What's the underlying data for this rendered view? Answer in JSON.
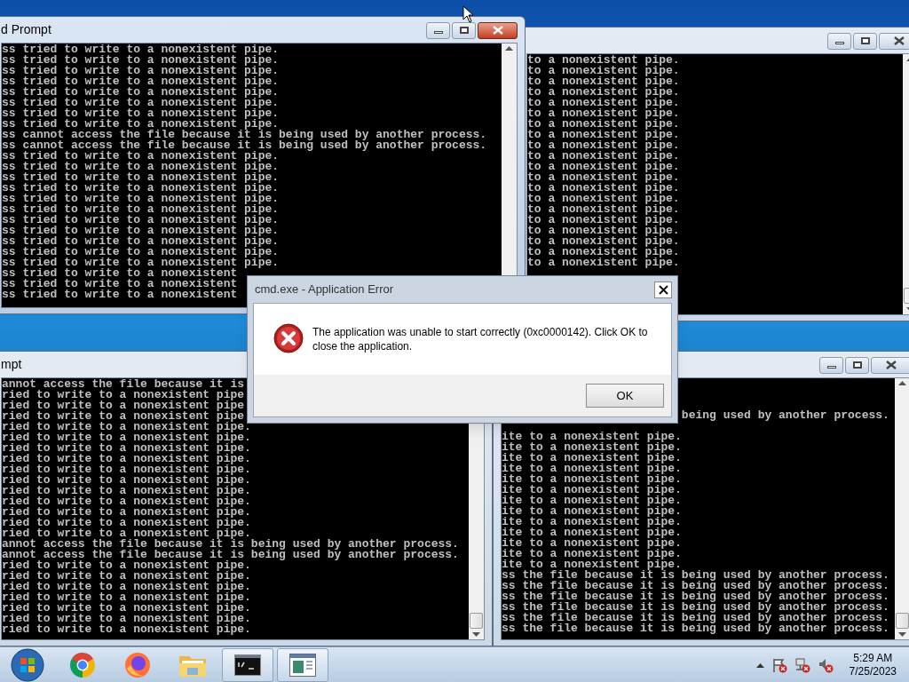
{
  "windows": [
    {
      "title": "d Prompt",
      "active": true,
      "lines": [
        {
          "kind": "full",
          "text": "ss tried to write to a nonexistent pipe."
        },
        {
          "kind": "full",
          "text": "ss tried to write to a nonexistent pipe."
        },
        {
          "kind": "full",
          "text": "ss tried to write to a nonexistent pipe."
        },
        {
          "kind": "full",
          "text": "ss tried to write to a nonexistent pipe."
        },
        {
          "kind": "full",
          "text": "ss tried to write to a nonexistent pipe."
        },
        {
          "kind": "full",
          "text": "ss tried to write to a nonexistent pipe."
        },
        {
          "kind": "full",
          "text": "ss tried to write to a nonexistent pipe."
        },
        {
          "kind": "full",
          "text": "ss tried to write to a nonexistent pipe."
        },
        {
          "kind": "full",
          "text": "ss cannot access the file because it is being used by another process."
        },
        {
          "kind": "full",
          "text": "ss cannot access the file because it is being used by another process."
        },
        {
          "kind": "full",
          "text": "ss tried to write to a nonexistent pipe."
        },
        {
          "kind": "full",
          "text": "ss tried to write to a nonexistent pipe."
        },
        {
          "kind": "full",
          "text": "ss tried to write to a nonexistent pipe."
        },
        {
          "kind": "full",
          "text": "ss tried to write to a nonexistent pipe."
        },
        {
          "kind": "full",
          "text": "ss tried to write to a nonexistent pipe."
        },
        {
          "kind": "full",
          "text": "ss tried to write to a nonexistent pipe."
        },
        {
          "kind": "full",
          "text": "ss tried to write to a nonexistent pipe."
        },
        {
          "kind": "full",
          "text": "ss tried to write to a nonexistent pipe."
        },
        {
          "kind": "full",
          "text": "ss tried to write to a nonexistent pipe."
        },
        {
          "kind": "full",
          "text": "ss tried to write to a nonexistent pipe."
        },
        {
          "kind": "full",
          "text": "ss tried to write to a nonexistent pipe."
        },
        {
          "kind": "full",
          "text": "ss tried to write to a nonexistent"
        },
        {
          "kind": "full",
          "text": "ss tried to write to a nonexistent"
        },
        {
          "kind": "full",
          "text": "ss tried to write to a nonexistent"
        }
      ]
    },
    {
      "active": false,
      "lines": [
        {
          "kind": "full",
          "text": "to a nonexistent pipe."
        },
        {
          "kind": "full",
          "text": "to a nonexistent pipe."
        },
        {
          "kind": "full",
          "text": "to a nonexistent pipe."
        },
        {
          "kind": "full",
          "text": "to a nonexistent pipe."
        },
        {
          "kind": "full",
          "text": "to a nonexistent pipe."
        },
        {
          "kind": "full",
          "text": "to a nonexistent pipe."
        },
        {
          "kind": "full",
          "text": "to a nonexistent pipe."
        },
        {
          "kind": "full",
          "text": "to a nonexistent pipe."
        },
        {
          "kind": "full",
          "text": "to a nonexistent pipe."
        },
        {
          "kind": "full",
          "text": "to a nonexistent pipe."
        },
        {
          "kind": "full",
          "text": "to a nonexistent pipe."
        },
        {
          "kind": "full",
          "text": "to a nonexistent pipe."
        },
        {
          "kind": "full",
          "text": "to a nonexistent pipe."
        },
        {
          "kind": "full",
          "text": "to a nonexistent pipe."
        },
        {
          "kind": "full",
          "text": "to a nonexistent pipe."
        },
        {
          "kind": "full",
          "text": "to a nonexistent pipe."
        },
        {
          "kind": "full",
          "text": "to a nonexistent pipe."
        },
        {
          "kind": "full",
          "text": "to a nonexistent pipe."
        },
        {
          "kind": "full",
          "text": "to a nonexistent pipe."
        },
        {
          "kind": "full",
          "text": "to a nonexistent pipe."
        }
      ]
    },
    {
      "title": "mpt",
      "active": false,
      "lines": [
        {
          "kind": "full",
          "text": "annot access the file because it is"
        },
        {
          "kind": "full",
          "text": "ried to write to a nonexistent pipe"
        },
        {
          "kind": "full",
          "text": "ried to write to a nonexistent pipe"
        },
        {
          "kind": "full",
          "text": "ried to write to a nonexistent pipe"
        },
        {
          "kind": "full",
          "text": "ried to write to a nonexistent pipe."
        },
        {
          "kind": "full",
          "text": "ried to write to a nonexistent pipe."
        },
        {
          "kind": "full",
          "text": "ried to write to a nonexistent pipe."
        },
        {
          "kind": "full",
          "text": "ried to write to a nonexistent pipe."
        },
        {
          "kind": "full",
          "text": "ried to write to a nonexistent pipe."
        },
        {
          "kind": "full",
          "text": "ried to write to a nonexistent pipe."
        },
        {
          "kind": "full",
          "text": "ried to write to a nonexistent pipe."
        },
        {
          "kind": "full",
          "text": "ried to write to a nonexistent pipe."
        },
        {
          "kind": "full",
          "text": "ried to write to a nonexistent pipe."
        },
        {
          "kind": "full",
          "text": "ried to write to a nonexistent pipe."
        },
        {
          "kind": "full",
          "text": "ried to write to a nonexistent pipe."
        },
        {
          "kind": "full",
          "text": "annot access the file because it is being used by another process."
        },
        {
          "kind": "full",
          "text": "annot access the file because it is being used by another process."
        },
        {
          "kind": "full",
          "text": "ried to write to a nonexistent pipe."
        },
        {
          "kind": "full",
          "text": "ried to write to a nonexistent pipe."
        },
        {
          "kind": "full",
          "text": "ried to write to a nonexistent pipe."
        },
        {
          "kind": "full",
          "text": "ried to write to a nonexistent pipe."
        },
        {
          "kind": "full",
          "text": "ried to write to a nonexistent pipe."
        },
        {
          "kind": "full",
          "text": "ried to write to a nonexistent pipe."
        },
        {
          "kind": "full",
          "text": "ried to write to a nonexistent pipe."
        }
      ]
    },
    {
      "active": false,
      "lines": [
        {
          "kind": "tail",
          "text": "being used by another process."
        },
        {
          "kind": "full",
          "text": "ite to a nonexistent pipe."
        },
        {
          "kind": "full",
          "text": "ite to a nonexistent pipe."
        },
        {
          "kind": "full",
          "text": "ite to a nonexistent pipe."
        },
        {
          "kind": "full",
          "text": "ite to a nonexistent pipe."
        },
        {
          "kind": "full",
          "text": "ite to a nonexistent pipe."
        },
        {
          "kind": "full",
          "text": "ite to a nonexistent pipe."
        },
        {
          "kind": "full",
          "text": "ite to a nonexistent pipe."
        },
        {
          "kind": "full",
          "text": "ite to a nonexistent pipe."
        },
        {
          "kind": "full",
          "text": "ite to a nonexistent pipe."
        },
        {
          "kind": "full",
          "text": "ite to a nonexistent pipe."
        },
        {
          "kind": "full",
          "text": "ite to a nonexistent pipe."
        },
        {
          "kind": "full",
          "text": "ite to a nonexistent pipe."
        },
        {
          "kind": "full",
          "text": "ite to a nonexistent pipe."
        },
        {
          "kind": "full",
          "text": "ss the file because it is being used by another process."
        },
        {
          "kind": "full",
          "text": "ss the file because it is being used by another process."
        },
        {
          "kind": "full",
          "text": "ss the file because it is being used by another process."
        },
        {
          "kind": "full",
          "text": "ss the file because it is being used by another process."
        },
        {
          "kind": "full",
          "text": "ss the file because it is being used by another process."
        },
        {
          "kind": "full",
          "text": "ss the file because it is being used by another process."
        }
      ]
    }
  ],
  "dialog": {
    "title": "cmd.exe - Application Error",
    "message": "The application was unable to start correctly (0xc0000142). Click OK to close the application.",
    "button": "OK"
  },
  "taskbar": {
    "items": [
      {
        "kind": "start",
        "running": false
      },
      {
        "kind": "browser",
        "running": false
      },
      {
        "kind": "fox",
        "running": false
      },
      {
        "kind": "folder",
        "running": false
      },
      {
        "kind": "console",
        "running": true
      },
      {
        "kind": "document",
        "running": true
      }
    ],
    "time": "5:29 AM",
    "date": "7/25/2023"
  }
}
